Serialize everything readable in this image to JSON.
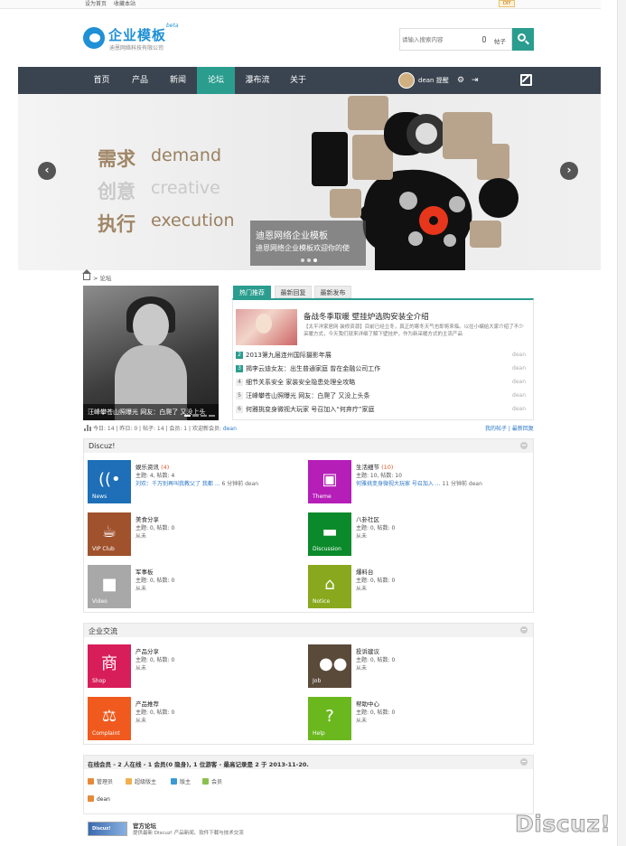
{
  "topbar": {
    "set_home": "设为首页",
    "bookmark": "收藏本站",
    "diy": "DIY"
  },
  "header": {
    "logo_title": "企业模板",
    "logo_beta": "beta",
    "logo_subtitle": "迪恩网络科技有限公司"
  },
  "search": {
    "placeholder": "请输入搜索内容",
    "type": "帖子"
  },
  "nav": {
    "items": [
      "首页",
      "产品",
      "新闻",
      "论坛",
      "瀑布流",
      "关于"
    ],
    "active": "论坛",
    "username": "dean",
    "notice": "提醒"
  },
  "banner": {
    "lines": [
      {
        "cn": "需求",
        "en": "demand"
      },
      {
        "cn": "创意",
        "en": "creative"
      },
      {
        "cn": "执行",
        "en": "execution"
      }
    ],
    "caption_title": "迪恩网络企业模板",
    "caption_sub": "迪恩网络企业模板欢迎你的使",
    "prev": "‹",
    "next": "›"
  },
  "breadcrumb": {
    "current": "论坛"
  },
  "slideshow": {
    "caption": "汪峰攀苍山照曝光 网友：白爬了 又没上头"
  },
  "tabs": [
    "热门推荐",
    "最新回复",
    "最新发布"
  ],
  "featured": {
    "title": "备战冬季取暖 壁挂炉选购安装全介绍",
    "text": "【太平洋家居网 装修资源】目前已经立冬，真正的寒冬天气也即将来临。以往小编给大家介绍了不少采暖方式，今天我们就来详细了解下壁挂炉，作为新采暖方式的主流产品"
  },
  "news": [
    {
      "num": "2",
      "title": "2013第九届连州国际摄影年展",
      "author": "dean"
    },
    {
      "num": "3",
      "title": "揭李云迪女友：出生普通家庭 曾在金融公司工作",
      "author": "dean"
    },
    {
      "num": "4",
      "title": "细节关系安全 家装安全隐患处理全攻略",
      "author": "dean"
    },
    {
      "num": "5",
      "title": "汪峰攀苍山照曝光 网友：白爬了 又没上头条",
      "author": "dean"
    },
    {
      "num": "6",
      "title": "何雅挑变身微视大玩家 号召加入“何弃疗”家庭",
      "author": "dean"
    }
  ],
  "stats": {
    "text": "今日: 14 | 昨日: 0 | 帖子: 14 | 会员: 1 | 欢迎新会员: ",
    "new_member": "dean",
    "my_posts": "我的帖子",
    "latest": "最新回复"
  },
  "sections": [
    {
      "title": "Discuz!",
      "forums": [
        {
          "name": "娱乐资讯",
          "count": " (4)",
          "stat": "主题: 4, 帖数: 4",
          "last_link": "刘欢：千万别再叫我教父了 我都 ...",
          "last_meta": " 6 分钟前 dean",
          "label": "News",
          "color": "#1e6fb8",
          "glyph": "((•"
        },
        {
          "name": "生活细节",
          "count": " (10)",
          "stat": "主题: 10, 帖数: 10",
          "last_link": "何雅挑变身微视大玩家 号召加入 ...",
          "last_meta": " 11 分钟前 dean",
          "label": "Theme",
          "color": "#b61eb8",
          "glyph": "▣"
        },
        {
          "name": "美食分享",
          "count": "",
          "stat": "主题: 0, 帖数: 0",
          "last_link": "",
          "last_meta": "从未",
          "label": "VIP Club",
          "color": "#a0522d",
          "glyph": "☕"
        },
        {
          "name": "八卦社区",
          "count": "",
          "stat": "主题: 0, 帖数: 0",
          "last_link": "",
          "last_meta": "从未",
          "label": "Discussion",
          "color": "#0a8a2a",
          "glyph": "▬"
        },
        {
          "name": "军事板",
          "count": "",
          "stat": "主题: 0, 帖数: 0",
          "last_link": "",
          "last_meta": "从未",
          "label": "Video",
          "color": "#a8a8a8",
          "glyph": "■"
        },
        {
          "name": "爆料台",
          "count": "",
          "stat": "主题: 0, 帖数: 0",
          "last_link": "",
          "last_meta": "从未",
          "label": "Notice",
          "color": "#8aa81e",
          "glyph": "⌂"
        }
      ]
    },
    {
      "title": "企业交流",
      "forums": [
        {
          "name": "产品分享",
          "count": "",
          "stat": "主题: 0, 帖数: 0",
          "last_link": "",
          "last_meta": "从未",
          "label": "Shop",
          "color": "#d81e5a",
          "glyph": "商"
        },
        {
          "name": "投诉建议",
          "count": "",
          "stat": "主题: 0, 帖数: 0",
          "last_link": "",
          "last_meta": "从未",
          "label": "Job",
          "color": "#5a4a3a",
          "glyph": "●●"
        },
        {
          "name": "产品推荐",
          "count": "",
          "stat": "主题: 0, 帖数: 0",
          "last_link": "",
          "last_meta": "从未",
          "label": "Complaint",
          "color": "#f05a1e",
          "glyph": "⚖"
        },
        {
          "name": "帮助中心",
          "count": "",
          "stat": "主题: 0, 帖数: 0",
          "last_link": "",
          "last_meta": "从未",
          "label": "Help",
          "color": "#6ab81e",
          "glyph": "?"
        }
      ]
    }
  ],
  "online": {
    "text": "在线会员 - 2 人在线 - 1 会员(0 隐身), 1 位游客 - 最高记录是 2 于 2013-11-20.",
    "legend": [
      "管理员",
      "超级版主",
      "版主",
      "会员"
    ],
    "legend_colors": [
      "#e58a3a",
      "#f0b050",
      "#3a9ad6",
      "#8ac050"
    ],
    "user": "dean"
  },
  "flink": {
    "title": "官方论坛",
    "desc": "提供最新 Discuz! 产品新闻、软件下载与技术交流",
    "img_text": "Discuz!"
  },
  "watermark": "Discuz!"
}
